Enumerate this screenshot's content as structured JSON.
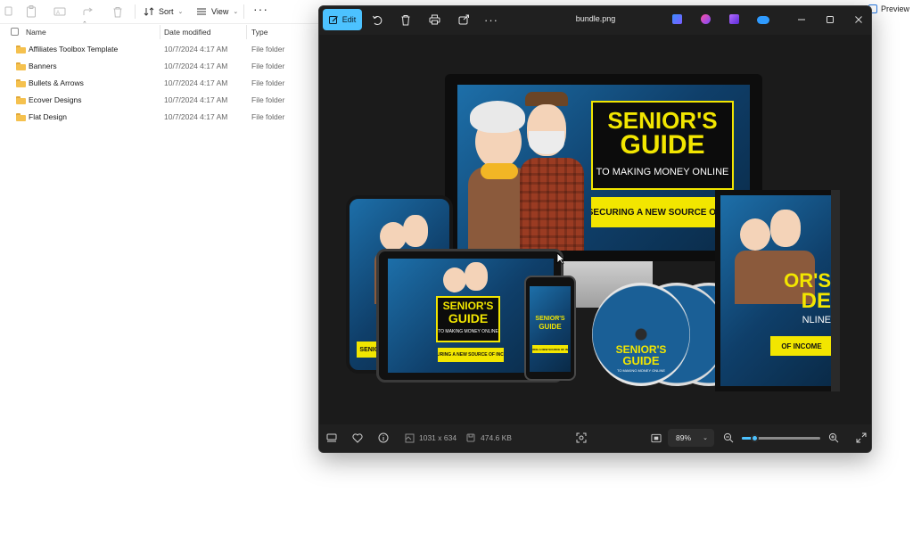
{
  "explorer": {
    "toolbar": {
      "sort_label": "Sort",
      "view_label": "View",
      "preview_label": "Preview"
    },
    "columns": {
      "name": "Name",
      "date_modified": "Date modified",
      "type": "Type"
    },
    "files": [
      {
        "name": "Affiliates Toolbox Template",
        "date": "10/7/2024 4:17 AM",
        "type": "File folder"
      },
      {
        "name": "Banners",
        "date": "10/7/2024 4:17 AM",
        "type": "File folder"
      },
      {
        "name": "Bullets & Arrows",
        "date": "10/7/2024 4:17 AM",
        "type": "File folder"
      },
      {
        "name": "Ecover Designs",
        "date": "10/7/2024 4:17 AM",
        "type": "File folder"
      },
      {
        "name": "Flat Design",
        "date": "10/7/2024 4:17 AM",
        "type": "File folder"
      }
    ]
  },
  "viewer": {
    "edit_label": "Edit",
    "title": "bundle.png",
    "accent": "#4cc2ff",
    "status": {
      "dimensions": "1031 x 634",
      "file_size": "474.6 KB",
      "zoom": "89%",
      "zoom_slider_fraction": 0.16
    },
    "artwork": {
      "title_line1": "SENIOR'S",
      "title_line2": "GUIDE",
      "subtitle": "TO MAKING MONEY ONLINE",
      "band": "SECURING A NEW SOURCE OF INCOME",
      "band_monitor": "SECURING A NEW SOURCE OF INCOM",
      "band_book": "OF INCOME",
      "cd_line1": "SENIOR'S",
      "cd_line2": "GUIDE",
      "cd_sub": "TO MAKING MONEY ONLINE",
      "book_title_1": "OR'S",
      "book_title_2": "DE",
      "book_sub": "NLINE"
    }
  }
}
